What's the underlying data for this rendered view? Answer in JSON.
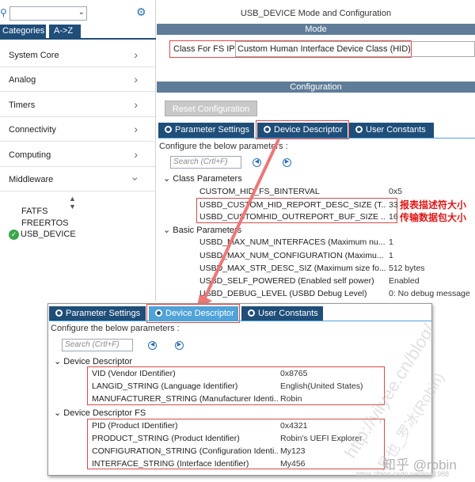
{
  "left_panel": {
    "search_placeholder": "",
    "tabs": [
      "Categories",
      "A->Z"
    ],
    "categories": [
      "System Core",
      "Analog",
      "Timers",
      "Connectivity",
      "Computing",
      "Middleware"
    ],
    "middleware_items": [
      "FATFS",
      "FREERTOS",
      "USB_DEVICE"
    ]
  },
  "header": {
    "title": "USB_DEVICE Mode and Configuration",
    "mode_label": "Mode",
    "class_label": "Class For FS IP",
    "class_value": "Custom Human Interface Device Class (HID)",
    "configuration_label": "Configuration",
    "reset_button": "Reset Configuration"
  },
  "tabs": [
    "Parameter Settings",
    "Device Descriptor",
    "User Constants"
  ],
  "configure_text": "Configure the below parameters :",
  "search_placeholder": "Search (Crtl+F)",
  "class_parameters": {
    "group": "Class Parameters",
    "rows": [
      {
        "name": "CUSTOM_HID_FS_BINTERVAL",
        "value": "0x5"
      },
      {
        "name": "USBD_CUSTOM_HID_REPORT_DESC_SIZE (T...",
        "value": "33"
      },
      {
        "name": "USBD_CUSTOMHID_OUTREPORT_BUF_SIZE ...",
        "value": "16"
      }
    ]
  },
  "annotations": [
    "报表描述符大小",
    "传输数据包大小"
  ],
  "basic_parameters": {
    "group": "Basic Parameters",
    "rows": [
      {
        "name": "USBD_MAX_NUM_INTERFACES (Maximum nu...",
        "value": "1"
      },
      {
        "name": "USBD_MAX_NUM_CONFIGURATION (Maximu...",
        "value": "1"
      },
      {
        "name": "USBD_MAX_STR_DESC_SIZ (Maximum size fo...",
        "value": "512 bytes"
      },
      {
        "name": "USBD_SELF_POWERED (Enabled self power)",
        "value": "Enabled"
      },
      {
        "name": "USBD_DEBUG_LEVEL (USBD Debug Level)",
        "value": "0: No debug message"
      }
    ]
  },
  "overlay": {
    "device_descriptor": {
      "group": "Device Descriptor",
      "rows": [
        {
          "name": "VID (Vendor IDentifier)",
          "value": "0x8765"
        },
        {
          "name": "LANGID_STRING (Language Identifier)",
          "value": "English(United States)"
        },
        {
          "name": "MANUFACTURER_STRING (Manufacturer Identi...",
          "value": "Robin"
        }
      ]
    },
    "device_descriptor_fs": {
      "group": "Device Descriptor FS",
      "rows": [
        {
          "name": "PID (Product IDentifier)",
          "value": "0x4321"
        },
        {
          "name": "PRODUCT_STRING (Product Identifier)",
          "value": "Robin's UEFI Explorer"
        },
        {
          "name": "CONFIGURATION_STRING (Configuration Identi...",
          "value": "My123"
        },
        {
          "name": "INTERFACE_STRING (Interface Identifier)",
          "value": "My456"
        }
      ]
    }
  },
  "watermark": {
    "url": "http://yiiyee.cn/blog/",
    "author": "易也_罗冰(Robin)",
    "zhihu": "知乎 @robin",
    "csdn": "https://blog.csdn.net/ling1988"
  },
  "colors": {
    "tab_dark": "#1f4e79",
    "tab_active": "#4fa3d9",
    "section_bar": "#5f7d98",
    "highlight_red": "#d94a4a",
    "annotation_red": "#e01616"
  }
}
